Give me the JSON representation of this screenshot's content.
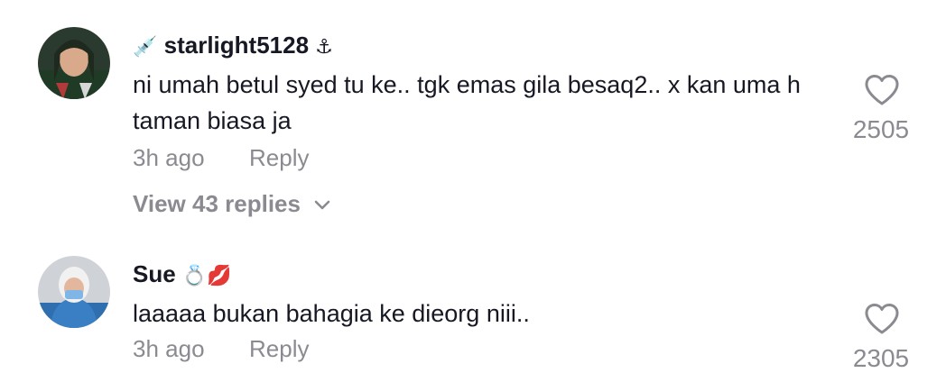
{
  "comments": [
    {
      "username": "starlight5128",
      "prefix_emoji": "💉",
      "suffix_emoji": "⚓",
      "text": "ni umah betul syed tu ke.. tgk emas gila besaq2.. x kan uma h taman biasa ja",
      "time": "3h ago",
      "reply_label": "Reply",
      "likes": "2505",
      "view_replies": "View 43 replies"
    },
    {
      "username": "Sue",
      "suffix_emoji": "💍💋",
      "text": "laaaaa bukan bahagia ke dieorg niii..",
      "time": "3h ago",
      "reply_label": "Reply",
      "likes": "2305"
    }
  ],
  "icons": {
    "like": "heart-outline-icon",
    "expand": "chevron-down-icon"
  },
  "colors": {
    "text_primary": "#161823",
    "text_secondary": "#8a8b91"
  }
}
